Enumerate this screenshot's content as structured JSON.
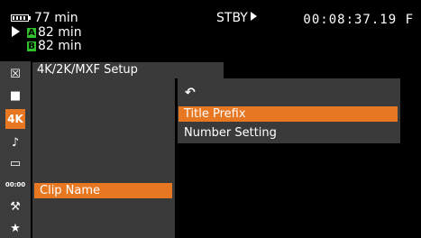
{
  "status": {
    "battery_remaining": "77 min",
    "slot_a_label": "A",
    "slot_a_remaining": "82 min",
    "slot_b_label": "B",
    "slot_b_remaining": "82 min",
    "mode": "STBY",
    "timecode": "00:08:37.19 F"
  },
  "sidebar": {
    "items": [
      {
        "icon": "close-icon",
        "glyph": "☒"
      },
      {
        "icon": "camera-icon",
        "glyph": "■"
      },
      {
        "icon": "4k-icon",
        "glyph": "4K",
        "active": true
      },
      {
        "icon": "audio-icon",
        "glyph": "♪"
      },
      {
        "icon": "media-icon",
        "glyph": "▭"
      },
      {
        "icon": "timecode-icon",
        "glyph": "00:00"
      },
      {
        "icon": "wrench-icon",
        "glyph": "⚒"
      },
      {
        "icon": "star-icon",
        "glyph": "★"
      }
    ]
  },
  "menu": {
    "title": "4K/2K/MXF Setup",
    "col1_selected": "Clip Name",
    "back_glyph": "↶",
    "col2_items": [
      "Title Prefix",
      "Number Setting"
    ],
    "selected_color": "#e87722"
  }
}
